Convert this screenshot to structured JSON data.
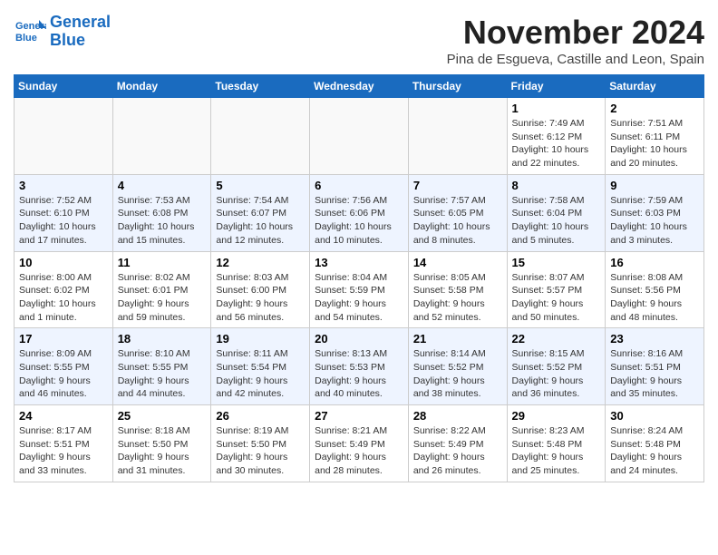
{
  "header": {
    "logo_line1": "General",
    "logo_line2": "Blue",
    "month": "November 2024",
    "location": "Pina de Esgueva, Castille and Leon, Spain"
  },
  "weekdays": [
    "Sunday",
    "Monday",
    "Tuesday",
    "Wednesday",
    "Thursday",
    "Friday",
    "Saturday"
  ],
  "weeks": [
    [
      {
        "day": "",
        "info": ""
      },
      {
        "day": "",
        "info": ""
      },
      {
        "day": "",
        "info": ""
      },
      {
        "day": "",
        "info": ""
      },
      {
        "day": "",
        "info": ""
      },
      {
        "day": "1",
        "info": "Sunrise: 7:49 AM\nSunset: 6:12 PM\nDaylight: 10 hours and 22 minutes."
      },
      {
        "day": "2",
        "info": "Sunrise: 7:51 AM\nSunset: 6:11 PM\nDaylight: 10 hours and 20 minutes."
      }
    ],
    [
      {
        "day": "3",
        "info": "Sunrise: 7:52 AM\nSunset: 6:10 PM\nDaylight: 10 hours and 17 minutes."
      },
      {
        "day": "4",
        "info": "Sunrise: 7:53 AM\nSunset: 6:08 PM\nDaylight: 10 hours and 15 minutes."
      },
      {
        "day": "5",
        "info": "Sunrise: 7:54 AM\nSunset: 6:07 PM\nDaylight: 10 hours and 12 minutes."
      },
      {
        "day": "6",
        "info": "Sunrise: 7:56 AM\nSunset: 6:06 PM\nDaylight: 10 hours and 10 minutes."
      },
      {
        "day": "7",
        "info": "Sunrise: 7:57 AM\nSunset: 6:05 PM\nDaylight: 10 hours and 8 minutes."
      },
      {
        "day": "8",
        "info": "Sunrise: 7:58 AM\nSunset: 6:04 PM\nDaylight: 10 hours and 5 minutes."
      },
      {
        "day": "9",
        "info": "Sunrise: 7:59 AM\nSunset: 6:03 PM\nDaylight: 10 hours and 3 minutes."
      }
    ],
    [
      {
        "day": "10",
        "info": "Sunrise: 8:00 AM\nSunset: 6:02 PM\nDaylight: 10 hours and 1 minute."
      },
      {
        "day": "11",
        "info": "Sunrise: 8:02 AM\nSunset: 6:01 PM\nDaylight: 9 hours and 59 minutes."
      },
      {
        "day": "12",
        "info": "Sunrise: 8:03 AM\nSunset: 6:00 PM\nDaylight: 9 hours and 56 minutes."
      },
      {
        "day": "13",
        "info": "Sunrise: 8:04 AM\nSunset: 5:59 PM\nDaylight: 9 hours and 54 minutes."
      },
      {
        "day": "14",
        "info": "Sunrise: 8:05 AM\nSunset: 5:58 PM\nDaylight: 9 hours and 52 minutes."
      },
      {
        "day": "15",
        "info": "Sunrise: 8:07 AM\nSunset: 5:57 PM\nDaylight: 9 hours and 50 minutes."
      },
      {
        "day": "16",
        "info": "Sunrise: 8:08 AM\nSunset: 5:56 PM\nDaylight: 9 hours and 48 minutes."
      }
    ],
    [
      {
        "day": "17",
        "info": "Sunrise: 8:09 AM\nSunset: 5:55 PM\nDaylight: 9 hours and 46 minutes."
      },
      {
        "day": "18",
        "info": "Sunrise: 8:10 AM\nSunset: 5:55 PM\nDaylight: 9 hours and 44 minutes."
      },
      {
        "day": "19",
        "info": "Sunrise: 8:11 AM\nSunset: 5:54 PM\nDaylight: 9 hours and 42 minutes."
      },
      {
        "day": "20",
        "info": "Sunrise: 8:13 AM\nSunset: 5:53 PM\nDaylight: 9 hours and 40 minutes."
      },
      {
        "day": "21",
        "info": "Sunrise: 8:14 AM\nSunset: 5:52 PM\nDaylight: 9 hours and 38 minutes."
      },
      {
        "day": "22",
        "info": "Sunrise: 8:15 AM\nSunset: 5:52 PM\nDaylight: 9 hours and 36 minutes."
      },
      {
        "day": "23",
        "info": "Sunrise: 8:16 AM\nSunset: 5:51 PM\nDaylight: 9 hours and 35 minutes."
      }
    ],
    [
      {
        "day": "24",
        "info": "Sunrise: 8:17 AM\nSunset: 5:51 PM\nDaylight: 9 hours and 33 minutes."
      },
      {
        "day": "25",
        "info": "Sunrise: 8:18 AM\nSunset: 5:50 PM\nDaylight: 9 hours and 31 minutes."
      },
      {
        "day": "26",
        "info": "Sunrise: 8:19 AM\nSunset: 5:50 PM\nDaylight: 9 hours and 30 minutes."
      },
      {
        "day": "27",
        "info": "Sunrise: 8:21 AM\nSunset: 5:49 PM\nDaylight: 9 hours and 28 minutes."
      },
      {
        "day": "28",
        "info": "Sunrise: 8:22 AM\nSunset: 5:49 PM\nDaylight: 9 hours and 26 minutes."
      },
      {
        "day": "29",
        "info": "Sunrise: 8:23 AM\nSunset: 5:48 PM\nDaylight: 9 hours and 25 minutes."
      },
      {
        "day": "30",
        "info": "Sunrise: 8:24 AM\nSunset: 5:48 PM\nDaylight: 9 hours and 24 minutes."
      }
    ]
  ]
}
